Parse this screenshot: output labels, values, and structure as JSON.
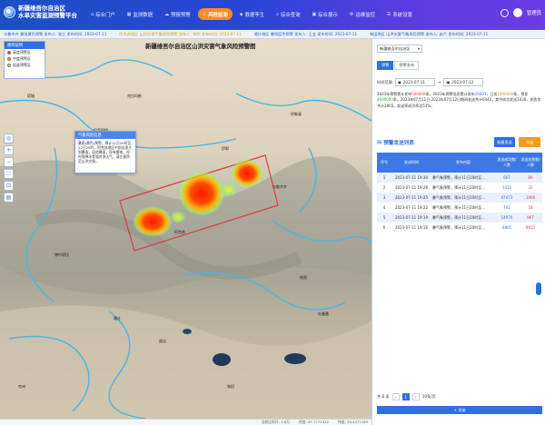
{
  "header": {
    "title_line1": "新疆维吾尔自治区",
    "title_line2": "水旱灾害监测预警平台",
    "nav": [
      {
        "label": "综合门户",
        "icon": "home-icon",
        "active": false
      },
      {
        "label": "监测数据",
        "icon": "monitor-icon",
        "active": false
      },
      {
        "label": "预报预警",
        "icon": "forecast-icon",
        "active": false
      },
      {
        "label": "风险监测",
        "icon": "risk-icon",
        "active": true
      },
      {
        "label": "数据孪生",
        "icon": "twin-icon",
        "active": false
      },
      {
        "label": "综合查询",
        "icon": "query-icon",
        "active": false
      },
      {
        "label": "综合展示",
        "icon": "display-icon",
        "active": false
      },
      {
        "label": "运维监控",
        "icon": "ops-icon",
        "active": false
      },
      {
        "label": "系统设置",
        "icon": "settings-icon",
        "active": false
      }
    ],
    "username": "管理员"
  },
  "ticker": [
    {
      "text": "乌鲁木齐 暴雨黄色预警 发布人: 张三 发布时间: 2023-07-11",
      "warn": false
    },
    {
      "text": "阿克苏地区 山洪灾害气象风险预警 发布人: 李四 发布时间: 2023-07-11",
      "warn": true
    },
    {
      "text": "喀什地区 暴雨蓝色预警 发布人: 王五 发布时间: 2023-07-11",
      "warn": false
    },
    {
      "text": "和田地区 山洪灾害气象风险预警 发布人: 赵六 发布时间: 2023-07-11",
      "warn": false
    }
  ],
  "map": {
    "title": "新疆维吾尔自治区山洪灾害气象风险预警图",
    "legend": {
      "title": "图例说明",
      "items": [
        {
          "label": "高度预警区",
          "color": "#e23b3b"
        },
        {
          "label": "中度预警区",
          "color": "#f59b21"
        },
        {
          "label": "低度预警区",
          "color": "#f4e14a"
        }
      ]
    },
    "places": [
      "巴音郭楞",
      "阿克苏",
      "伊犁",
      "塔城",
      "博尔塔拉",
      "昌吉",
      "哈密",
      "喀什",
      "和田",
      "克州",
      "吐鲁番",
      "克拉玛依",
      "阿勒泰",
      "乌鲁木齐"
    ],
    "popup": {
      "title": "气象风险信息",
      "body": "暴雨(黄色)预警，预计11日20时至12日20时，阿克苏地区中部出现大到暴雨，局地暴雨，伴有雷电、短时强降水等强对流天气，请注意防范山洪灾害。"
    },
    "tools": [
      "locate-icon",
      "zoom-in-icon",
      "zoom-out-icon",
      "fullscreen-icon",
      "measure-icon",
      "layers-icon"
    ],
    "status": {
      "scale": "当前比例尺: 1:8万",
      "coords": "经度: 87.7771412",
      "lat": "纬度: 39.4471289"
    }
  },
  "panel": {
    "region": "新疆维吾尔自治区",
    "tabs": [
      {
        "label": "预警",
        "active": true
      },
      {
        "label": "预警发布",
        "active": false
      }
    ],
    "filter_label": "时间范围",
    "date_from": "2023-07-11",
    "date_to": "2023-07-12",
    "summary": [
      {
        "text": "2023年预警累计发布",
        "cls": ""
      },
      {
        "text": "500000",
        "cls": "hl-red"
      },
      {
        "text": "条，2023年预警信息累计发布",
        "cls": ""
      },
      {
        "text": "20001",
        "cls": "hl-blue"
      },
      {
        "text": "，已发",
        "cls": ""
      },
      {
        "text": "1900000",
        "cls": "hl-orange"
      },
      {
        "text": "条，预发",
        "cls": ""
      },
      {
        "text": "4600000",
        "cls": "hl-green"
      },
      {
        "text": "条。2023年07月11日-2023年07月12日期间发送共计6442，其中成功发送1030，失败发共计2803，发送率成功率达53%。",
        "cls": ""
      }
    ],
    "list_title": "预警发送列表",
    "btn_primary": "批量发送",
    "btn_secondary": "导出",
    "columns": [
      "序号",
      "发送时间",
      "发布内容",
      "发送成功数/人数",
      "发送失败数/人数"
    ],
    "rows": [
      [
        "1",
        "2023-07-11 19:30",
        "暴气象预警，预计11日20时至…",
        "667",
        "80"
      ],
      [
        "2",
        "2023-07-11 19:28",
        "暴气象预警，预计11日20时至…",
        "1432",
        "32"
      ],
      [
        "3",
        "2023-07-11 19:25",
        "暴气象预警，预计11日20时至…",
        "47473",
        "1908"
      ],
      [
        "4",
        "2023-07-11 19:22",
        "暴气象预警，预计11日20时至…",
        "741",
        "54"
      ],
      [
        "5",
        "2023-07-11 19:19",
        "暴气象预警，预计11日20时至…",
        "14970",
        "967"
      ],
      [
        "6",
        "2023-07-11 19:16",
        "暴气象预警，预计11日20时至…",
        "6801",
        "8632"
      ]
    ],
    "pager_total": "共 6 条",
    "pager_size": "10条/页",
    "pager_current": "1",
    "add_label": "+ 添加"
  }
}
